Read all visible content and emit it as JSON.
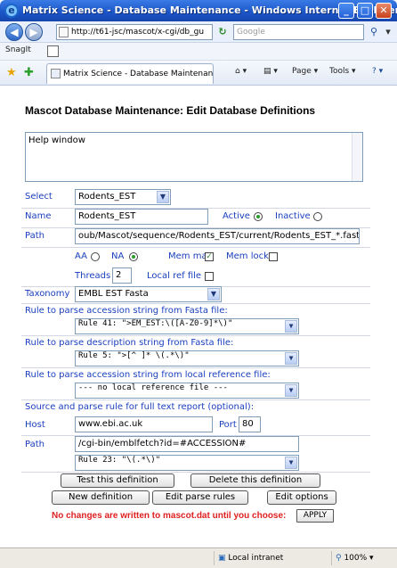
{
  "window": {
    "title": "Matrix Science - Database Maintenance - Windows Internet Explorer",
    "minimize": "_",
    "maximize": "□",
    "close": "✕"
  },
  "address_bar": {
    "url": "http://t61-jsc/mascot/x-cgi/db_gu",
    "search_placeholder": "Google"
  },
  "links_bar": {
    "snagit_label": "SnagIt"
  },
  "tab": {
    "label": "Matrix Science - Database Maintenance"
  },
  "toolbar": {
    "page_label": "Page",
    "tools_label": "Tools"
  },
  "page": {
    "heading": "Mascot Database Maintenance: Edit Database Definitions",
    "help_text": "Help window",
    "select_label": "Select",
    "select_value": "Rodents_EST",
    "name_label": "Name",
    "name_value": "Rodents_EST",
    "active_label": "Active",
    "inactive_label": "Inactive",
    "path_label": "Path",
    "path_value": "oub/Mascot/sequence/Rodents_EST/current/Rodents_EST_*.fasta",
    "aa_label": "AA",
    "na_label": "NA",
    "mem_map_label": "Mem map",
    "mem_lock_label": "Mem lock",
    "threads_label": "Threads",
    "threads_value": "2",
    "local_ref_label": "Local ref file",
    "taxonomy_label": "Taxonomy",
    "taxonomy_value": "EMBL EST Fasta",
    "rule_accession_label": "Rule to parse accession string from Fasta file:",
    "rule_accession_value": "Rule 41: \">EM_EST:\\([A-Z0-9]*\\)\"",
    "rule_description_label": "Rule to parse description string from Fasta file:",
    "rule_description_value": "Rule 5: \">[^ ]* \\(.*\\)\"",
    "rule_local_ref_label": "Rule to parse accession string from local reference file:",
    "rule_local_ref_value": "--- no local reference file ---",
    "source_label": "Source and parse rule for full text report (optional):",
    "host_label": "Host",
    "host_value": "www.ebi.ac.uk",
    "port_label": "Port",
    "port_value": "80",
    "report_path_label": "Path",
    "report_path_value": "/cgi-bin/emblfetch?id=#ACCESSION#",
    "rule_report_value": "Rule 23: \"\\(.*\\)\"",
    "test_button": "Test this definition",
    "delete_button": "Delete this definition",
    "new_button": "New definition",
    "edit_rules_button": "Edit parse rules",
    "edit_options_button": "Edit options",
    "warning": "No changes are written to mascot.dat until you choose:",
    "apply_button": "APPLY"
  },
  "state": {
    "active": true,
    "aa": false,
    "na": true,
    "mem_map": true,
    "mem_lock": false,
    "local_ref": false
  },
  "status_bar": {
    "zone": "Local intranet",
    "zoom": "100%"
  }
}
